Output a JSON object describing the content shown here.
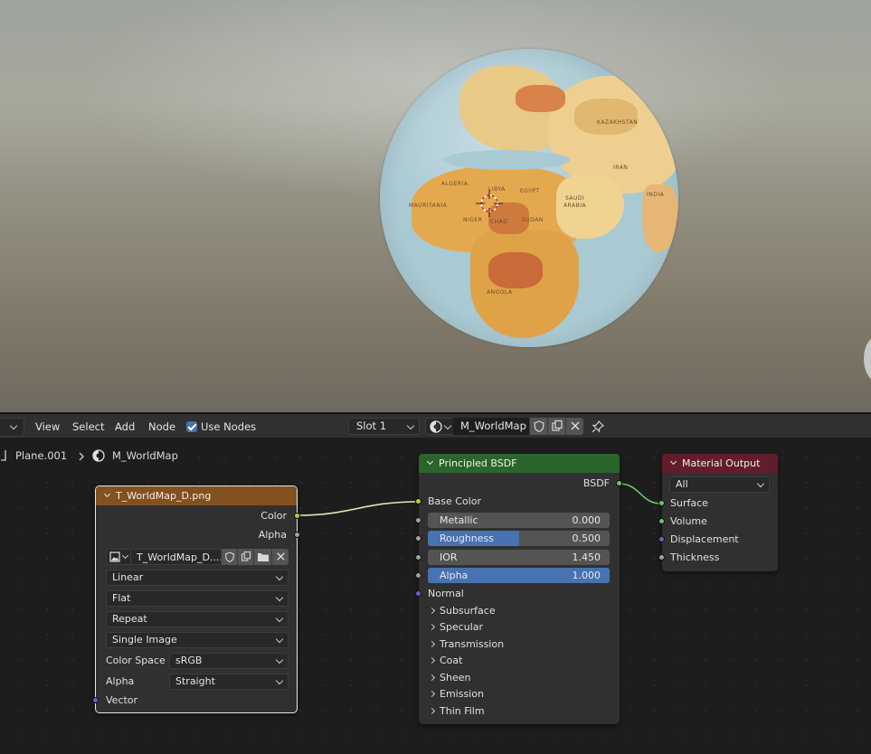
{
  "header": {
    "menu": [
      "View",
      "Select",
      "Add",
      "Node"
    ],
    "use_nodes_label": "Use Nodes",
    "slot_label": "Slot 1",
    "material_name": "M_WorldMap"
  },
  "breadcrumb": {
    "object": "Plane.001",
    "material": "M_WorldMap"
  },
  "globe_labels": [
    "KAZAKHSTAN",
    "ALGERIA",
    "LIBYA",
    "EGYPT",
    "SAUDI",
    "ARABIA",
    "NIGER",
    "CHAD",
    "SUDAN",
    "MAURITANIA",
    "ANGOLA",
    "INDIA",
    "IRAN"
  ],
  "image_node": {
    "title": "T_WorldMap_D.png",
    "outputs": [
      "Color",
      "Alpha"
    ],
    "image_name": "T_WorldMap_D....",
    "interpolation": "Linear",
    "projection": "Flat",
    "extension": "Repeat",
    "source": "Single Image",
    "color_space_label": "Color Space",
    "color_space": "sRGB",
    "alpha_label": "Alpha",
    "alpha_mode": "Straight",
    "input": "Vector"
  },
  "bsdf_node": {
    "title": "Principled BSDF",
    "output": "BSDF",
    "base_color_label": "Base Color",
    "fields": [
      {
        "name": "Metallic",
        "value": "0.000",
        "fraction": 0.0
      },
      {
        "name": "Roughness",
        "value": "0.500",
        "fraction": 0.5
      },
      {
        "name": "IOR",
        "value": "1.450",
        "fraction": 0.0
      },
      {
        "name": "Alpha",
        "value": "1.000",
        "fraction": 1.0
      }
    ],
    "normal_label": "Normal",
    "panels": [
      "Subsurface",
      "Specular",
      "Transmission",
      "Coat",
      "Sheen",
      "Emission",
      "Thin Film"
    ]
  },
  "output_node": {
    "title": "Material Output",
    "target": "All",
    "inputs": [
      "Surface",
      "Volume",
      "Displacement",
      "Thickness"
    ]
  },
  "colors": {
    "image_header": "#83501f",
    "bsdf_header": "#2b652b",
    "output_header": "#631c2b",
    "accent": "#4772b3"
  }
}
